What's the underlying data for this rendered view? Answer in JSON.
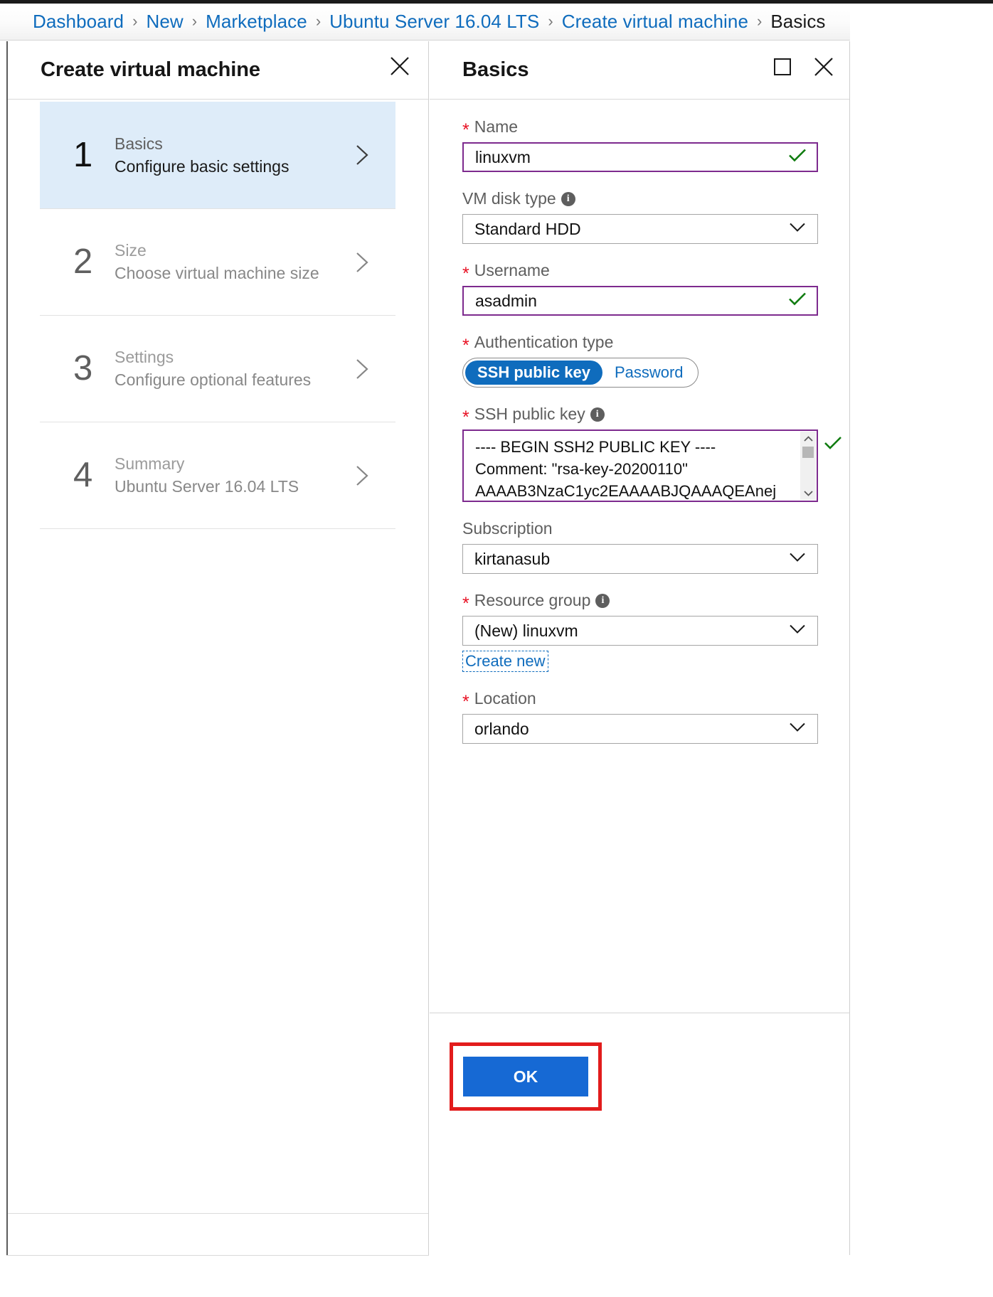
{
  "breadcrumb": {
    "items": [
      {
        "label": "Dashboard",
        "current": false
      },
      {
        "label": "New",
        "current": false
      },
      {
        "label": "Marketplace",
        "current": false
      },
      {
        "label": "Ubuntu Server 16.04 LTS",
        "current": false
      },
      {
        "label": "Create virtual machine",
        "current": false
      },
      {
        "label": "Basics",
        "current": true
      }
    ],
    "separator": "›"
  },
  "left_blade": {
    "title": "Create virtual machine",
    "close_label": "Close",
    "steps": [
      {
        "number": "1",
        "title": "Basics",
        "subtitle": "Configure basic settings"
      },
      {
        "number": "2",
        "title": "Size",
        "subtitle": "Choose virtual machine size"
      },
      {
        "number": "3",
        "title": "Settings",
        "subtitle": "Configure optional features"
      },
      {
        "number": "4",
        "title": "Summary",
        "subtitle": "Ubuntu Server 16.04 LTS"
      }
    ]
  },
  "right_blade": {
    "title": "Basics",
    "maximize_label": "Maximize",
    "close_label": "Close",
    "fields": {
      "name": {
        "label": "Name",
        "required": true,
        "value": "linuxvm",
        "validated": true
      },
      "vm_disk_type": {
        "label": "VM disk type",
        "required": false,
        "value": "Standard HDD",
        "has_info": true
      },
      "username": {
        "label": "Username",
        "required": true,
        "value": "asadmin",
        "validated": true
      },
      "authentication_type": {
        "label": "Authentication type",
        "required": true,
        "options": [
          "SSH public key",
          "Password"
        ],
        "selected": "SSH public key"
      },
      "ssh_public_key": {
        "label": "SSH public key",
        "required": true,
        "has_info": true,
        "validated": true,
        "lines": [
          "---- BEGIN SSH2 PUBLIC KEY ----",
          "Comment: \"rsa-key-20200110\"",
          "AAAAB3NzaC1yc2EAAAABJQAAAQEAnej"
        ]
      },
      "subscription": {
        "label": "Subscription",
        "required": false,
        "value": "kirtanasub"
      },
      "resource_group": {
        "label": "Resource group",
        "required": true,
        "has_info": true,
        "value": "(New) linuxvm",
        "create_new_label": "Create new"
      },
      "location": {
        "label": "Location",
        "required": false,
        "value": "orlando"
      }
    },
    "footer": {
      "ok_label": "OK"
    }
  },
  "colors": {
    "link_blue": "#0f6cbd",
    "accent_blue": "#1669d4",
    "selected_step_bg": "#deecf9",
    "validated_border": "#7d2a8e",
    "required_star": "#e81123",
    "valid_check": "#107c10",
    "highlight_red": "#e21c1c"
  }
}
